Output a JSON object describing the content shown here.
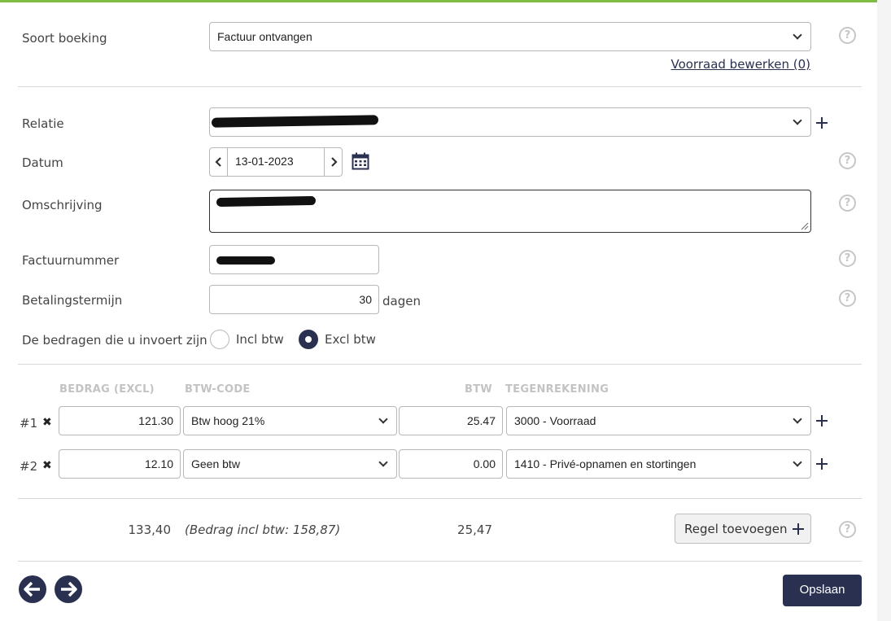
{
  "colors": {
    "accent_bar": "#7cbd42",
    "primary": "#2a3150",
    "help_grey": "#c6c6c6"
  },
  "booking": {
    "soort_label": "Soort boeking",
    "soort_value": "Factuur ontvangen",
    "voorraad_link": "Voorraad bewerken (0)"
  },
  "form": {
    "relatie_label": "Relatie",
    "datum_label": "Datum",
    "datum_value": "13-01-2023",
    "omschrijving_label": "Omschrijving",
    "factuurnummer_label": "Factuurnummer",
    "betalingstermijn_label": "Betalingstermijn",
    "betalingstermijn_value": "30",
    "betalingstermijn_unit": "dagen",
    "bedragen_label": "De bedragen die u invoert zijn",
    "incl_label": "Incl btw",
    "excl_label": "Excl btw",
    "selected_mode": "excl"
  },
  "columns": {
    "bedrag": "BEDRAG (EXCL)",
    "btw_code": "BTW-CODE",
    "btw": "BTW",
    "tegenrekening": "TEGENREKENING"
  },
  "rows": [
    {
      "index": "#1",
      "bedrag": "121.30",
      "btw_code": "Btw hoog 21%",
      "btw": "25.47",
      "tegenrekening": "3000 - Voorraad"
    },
    {
      "index": "#2",
      "bedrag": "12.10",
      "btw_code": "Geen btw",
      "btw": "0.00",
      "tegenrekening": "1410 - Privé-opnamen en stortingen"
    }
  ],
  "totals": {
    "bedrag": "133,40",
    "incl_note": "(Bedrag incl btw: 158,87)",
    "btw": "25,47"
  },
  "buttons": {
    "regel_toevoegen": "Regel toevoegen",
    "opslaan": "Opslaan"
  },
  "help_glyph": "?",
  "icons": {
    "remove": "✖",
    "help": "question-circle-icon",
    "add": "plus-icon",
    "calendar": "calendar-icon",
    "prev": "arrow-left-circle-icon",
    "next": "arrow-right-circle-icon"
  }
}
